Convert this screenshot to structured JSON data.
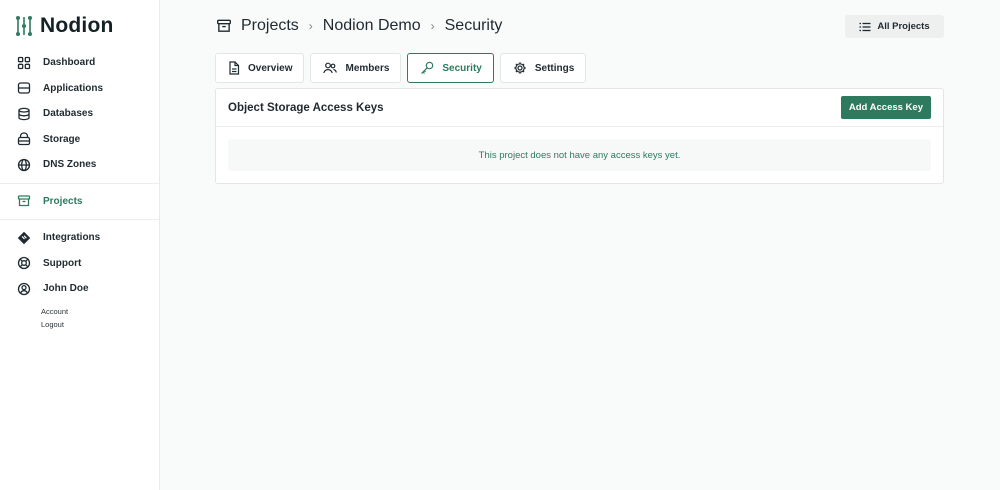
{
  "app": {
    "name": "Nodion"
  },
  "colors": {
    "accent": "#2e7a5e",
    "text": "#1f2a30"
  },
  "sidebar": {
    "primary": [
      {
        "label": "Dashboard",
        "icon": "grid-icon"
      },
      {
        "label": "Applications",
        "icon": "server-icon"
      },
      {
        "label": "Databases",
        "icon": "database-icon"
      },
      {
        "label": "Storage",
        "icon": "storage-icon"
      },
      {
        "label": "DNS Zones",
        "icon": "globe-icon"
      }
    ],
    "projects": {
      "label": "Projects",
      "icon": "archive-icon",
      "active": true
    },
    "secondary": [
      {
        "label": "Integrations",
        "icon": "integrations-icon"
      },
      {
        "label": "Support",
        "icon": "lifebuoy-icon"
      },
      {
        "label": "John Doe",
        "icon": "user-circle-icon"
      }
    ],
    "user_menu": [
      "Account",
      "Logout"
    ]
  },
  "breadcrumb": [
    "Projects",
    "Nodion Demo",
    "Security"
  ],
  "header": {
    "all_projects_label": "All Projects"
  },
  "tabs": [
    {
      "label": "Overview",
      "icon": "document-icon"
    },
    {
      "label": "Members",
      "icon": "users-icon"
    },
    {
      "label": "Security",
      "icon": "key-icon",
      "active": true
    },
    {
      "label": "Settings",
      "icon": "gear-icon"
    }
  ],
  "card": {
    "title": "Object Storage Access Keys",
    "add_button": "Add Access Key",
    "empty_message": "This project does not have any access keys yet."
  }
}
